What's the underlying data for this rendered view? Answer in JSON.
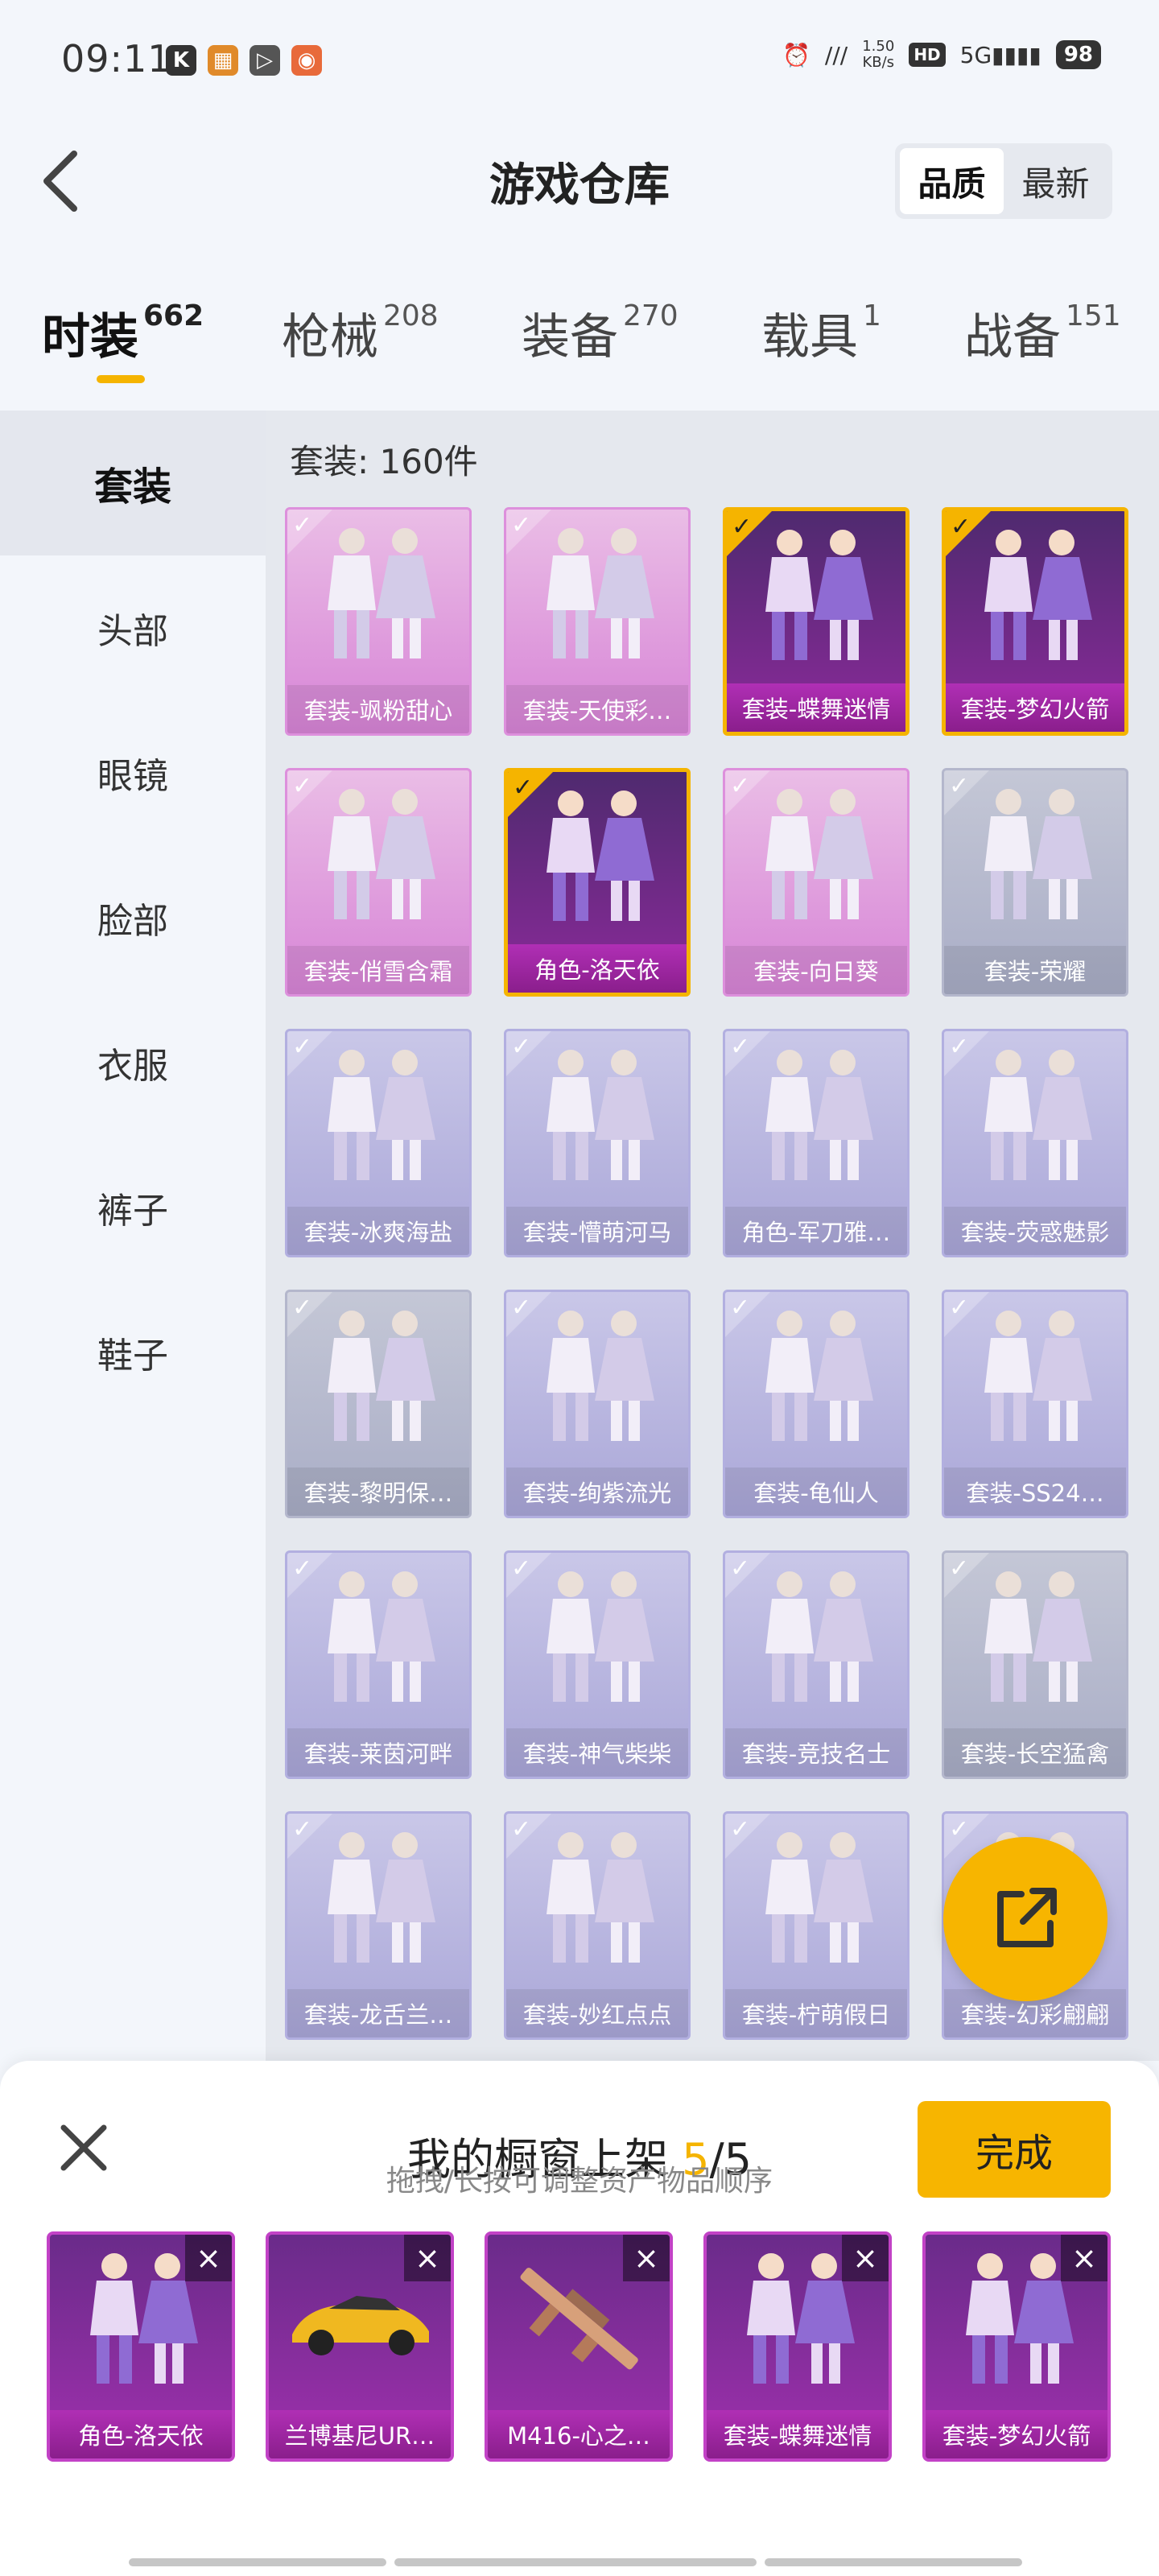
{
  "status_bar": {
    "time": "09:11",
    "net_speed": "1.50",
    "net_unit": "KB/s",
    "hd": "HD",
    "signal": "5G",
    "battery": "98"
  },
  "header": {
    "title": "游戏仓库",
    "sort_quality": "品质",
    "sort_latest": "最新"
  },
  "tabs": [
    {
      "label": "时装",
      "count": "662"
    },
    {
      "label": "枪械",
      "count": "208"
    },
    {
      "label": "装备",
      "count": "270"
    },
    {
      "label": "载具",
      "count": "1"
    },
    {
      "label": "战备",
      "count": "151"
    }
  ],
  "sidebar": {
    "items": [
      "套装",
      "头部",
      "眼镜",
      "脸部",
      "衣服",
      "裤子",
      "鞋子"
    ]
  },
  "grid": {
    "header": "套装: 160件",
    "items": [
      {
        "label": "套装-飒粉甜心",
        "style": "pink",
        "selected": false
      },
      {
        "label": "套装-天使彩…",
        "style": "pink",
        "selected": false
      },
      {
        "label": "套装-蝶舞迷情",
        "style": "dark",
        "selected": true
      },
      {
        "label": "套装-梦幻火箭",
        "style": "dark",
        "selected": true
      },
      {
        "label": "套装-俏雪含霜",
        "style": "pink",
        "selected": false
      },
      {
        "label": "角色-洛天依",
        "style": "dark",
        "selected": true
      },
      {
        "label": "套装-向日葵",
        "style": "pink",
        "selected": false
      },
      {
        "label": "套装-荣耀",
        "style": "gray",
        "selected": false
      },
      {
        "label": "套装-冰爽海盐",
        "style": "lav",
        "selected": false
      },
      {
        "label": "套装-懵萌河马",
        "style": "lav",
        "selected": false
      },
      {
        "label": "角色-军刀雅…",
        "style": "lav",
        "selected": false
      },
      {
        "label": "套装-荧惑魅影",
        "style": "lav",
        "selected": false
      },
      {
        "label": "套装-黎明保…",
        "style": "gray",
        "selected": false
      },
      {
        "label": "套装-绚紫流光",
        "style": "lav",
        "selected": false
      },
      {
        "label": "套装-龟仙人",
        "style": "lav",
        "selected": false
      },
      {
        "label": "套装-SS24…",
        "style": "lav",
        "selected": false
      },
      {
        "label": "套装-莱茵河畔",
        "style": "lav",
        "selected": false
      },
      {
        "label": "套装-神气柴柴",
        "style": "lav",
        "selected": false
      },
      {
        "label": "套装-竞技名士",
        "style": "lav",
        "selected": false
      },
      {
        "label": "套装-长空猛禽",
        "style": "gray",
        "selected": false
      },
      {
        "label": "套装-龙舌兰…",
        "style": "lav",
        "selected": false
      },
      {
        "label": "套装-妙红点点",
        "style": "lav",
        "selected": false
      },
      {
        "label": "套装-柠萌假日",
        "style": "lav",
        "selected": false
      },
      {
        "label": "套装-幻彩翩翩",
        "style": "lav",
        "selected": false
      }
    ]
  },
  "sheet": {
    "title": "我的橱窗上架 ",
    "current": "5",
    "total": "/5",
    "done": "完成",
    "hint": "拖拽/长按可调整资产物品顺序",
    "items": [
      {
        "label": "角色-洛天依",
        "icon": "character-icon"
      },
      {
        "label": "兰博基尼UR…",
        "icon": "car-icon"
      },
      {
        "label": "M416-心之…",
        "icon": "rifle-icon"
      },
      {
        "label": "套装-蝶舞迷情",
        "icon": "outfit-icon"
      },
      {
        "label": "套装-梦幻火箭",
        "icon": "outfit-icon"
      }
    ]
  },
  "colors": {
    "accent": "#f7b500",
    "pink_card": "#d784d6",
    "lavender_card": "#aaa7d8",
    "selected_card": "#8b2a9a"
  }
}
